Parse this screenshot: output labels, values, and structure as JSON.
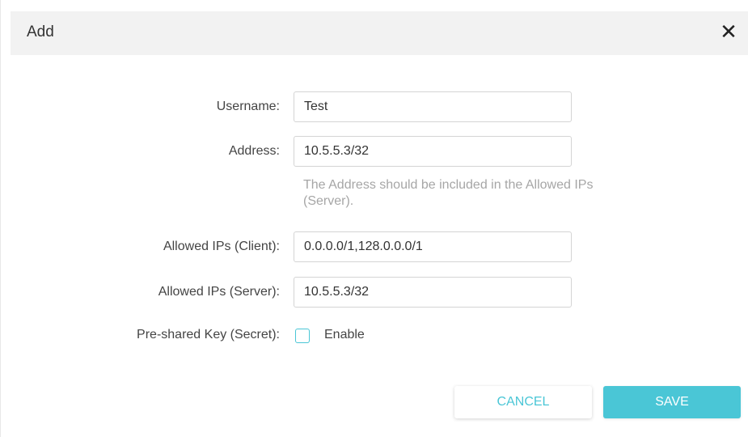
{
  "dialog": {
    "title": "Add",
    "close_icon": "close-icon"
  },
  "form": {
    "username": {
      "label": "Username:",
      "value": "Test"
    },
    "address": {
      "label": "Address:",
      "value": "10.5.5.3/32",
      "hint_line1": "The Address should be included in the Allowed IPs",
      "hint_line2": "(Server)."
    },
    "allowed_ips_client": {
      "label": "Allowed IPs (Client):",
      "value": "0.0.0.0/1,128.0.0.0/1"
    },
    "allowed_ips_server": {
      "label": "Allowed IPs (Server):",
      "value": "10.5.5.3/32"
    },
    "preshared_key": {
      "label": "Pre-shared Key (Secret):",
      "checkbox_label": "Enable",
      "checked": false
    }
  },
  "buttons": {
    "cancel_label": "CANCEL",
    "save_label": "SAVE"
  },
  "colors": {
    "accent": "#4ac6d6",
    "header_bg": "#f2f2f2",
    "hint_text": "#a6a6a6"
  }
}
